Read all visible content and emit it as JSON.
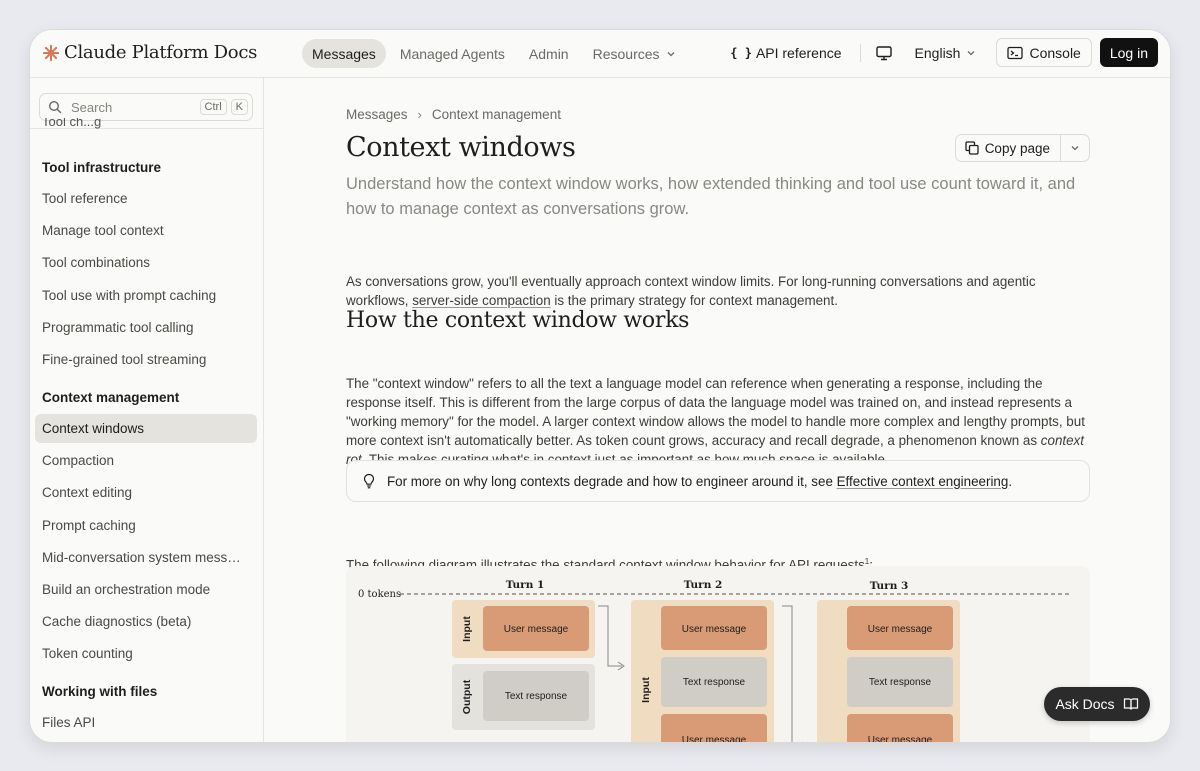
{
  "header": {
    "logo_text": "Claude Platform Docs",
    "nav": [
      {
        "label": "Messages",
        "active": true
      },
      {
        "label": "Managed Agents"
      },
      {
        "label": "Admin"
      },
      {
        "label": "Resources"
      }
    ],
    "api_reference": "API reference",
    "api_braces": "{ }",
    "language": "English",
    "console": "Console",
    "login": "Log in"
  },
  "sidebar": {
    "search_placeholder": "Search",
    "shortcut_ctrl": "Ctrl",
    "shortcut_k": "K",
    "cut_item": "Tool ch...g",
    "groups": [
      {
        "title": "Tool infrastructure",
        "items": [
          "Tool reference",
          "Manage tool context",
          "Tool combinations",
          "Tool use with prompt caching",
          "Programmatic tool calling",
          "Fine-grained tool streaming"
        ]
      },
      {
        "title": "Context management",
        "items": [
          "Context windows",
          "Compaction",
          "Context editing",
          "Prompt caching",
          "Mid-conversation system mess…",
          "Build an orchestration mode",
          "Cache diagnostics (beta)",
          "Token counting"
        ]
      },
      {
        "title": "Working with files",
        "items": [
          "Files API"
        ]
      }
    ],
    "active_item": "Context windows"
  },
  "main": {
    "breadcrumb": [
      "Messages",
      "Context management"
    ],
    "breadcrumb_sep": "›",
    "title": "Context windows",
    "copy_page": "Copy page",
    "subtitle": "Understand how the context window works, how extended thinking and tool use count toward it, and how to manage context as conversations grow.",
    "intro_1": "As conversations grow, you'll eventually approach context window limits. For long-running conversations and agentic workflows, ",
    "intro_link": "server-side compaction",
    "intro_2": " is the primary strategy for context management.",
    "h2": "How the context window works",
    "body_1": "The \"context window\" refers to all the text a language model can reference when generating a response, including the response itself. This is different from the large corpus of data the language model was trained on, and instead represents a \"working memory\" for the model. A larger context window allows the model to handle more complex and lengthy prompts, but more context isn't automatically better. As token count grows, accuracy and recall degrade, a phenomenon known as ",
    "body_em": "context rot",
    "body_2": ". This makes curating what's in context just as important as how much space is available.",
    "callout_1": "For more on why long contexts degrade and how to engineer around it, see ",
    "callout_link": "Effective context engineering",
    "callout_2": ".",
    "diagram_intro": "The following diagram illustrates the standard context window behavior for API requests",
    "diagram_footnote": "1",
    "diagram_intro_end": ":"
  },
  "diagram": {
    "zero_label": "0 tokens",
    "turns": [
      "Turn 1",
      "Turn 2",
      "Turn 3"
    ],
    "input_label": "Input",
    "output_label": "Output",
    "user_message": "User message",
    "text_response": "Text response"
  },
  "ask_docs": "Ask Docs",
  "colors": {
    "accent": "#d97757",
    "user_block": "#d99a76",
    "input_bg": "#f0dcc0",
    "output_bg": "#e3e2dc",
    "response_block": "#cfcdc6"
  }
}
